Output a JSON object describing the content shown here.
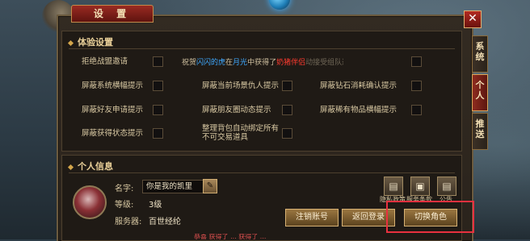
{
  "window": {
    "title": "设 置",
    "close": "✕"
  },
  "side_tabs": {
    "system": "系统",
    "personal": "个人",
    "push": "推送"
  },
  "experience": {
    "title": "体验设置",
    "options": [
      {
        "label": "拒绝战盟邀请"
      },
      {
        "label": "屏蔽系统横幅提示"
      },
      {
        "label": "屏蔽当前场景仇人提示"
      },
      {
        "label": "屏蔽钻石消耗确认提示"
      },
      {
        "label": "屏蔽好友申请提示"
      },
      {
        "label": "屏蔽朋友圈动态提示"
      },
      {
        "label": "屏蔽稀有物品横幅提示"
      },
      {
        "label": "屏蔽获得状态提示"
      },
      {
        "label": "整理背包自动绑定所有不可交易道具"
      }
    ],
    "marquee": {
      "p1": "祝贺",
      "p2": "闪闪的虎",
      "p3": "在",
      "p4": "月光",
      "p5": "中获得了",
      "p6": "奶猪伴侣",
      "p7": "动接受组队邀请"
    }
  },
  "personal": {
    "title": "个人信息",
    "name_label": "名字:",
    "name_value": "你是我的凯里",
    "level_label": "等级:",
    "level_value": "3级",
    "server_label": "服务器:",
    "server_value": "百世经纶",
    "edit_icon": "pencil-icon",
    "icon_buttons": [
      {
        "icon": "document-icon",
        "caption": "隐私政策"
      },
      {
        "icon": "gift-icon",
        "caption": "服务条款"
      },
      {
        "icon": "notice-icon",
        "caption": "公告"
      }
    ],
    "buttons": {
      "logout": "注销账号",
      "back_login": "返回登录",
      "switch_role": "切换角色"
    }
  },
  "bottom_text": "恭喜 获得了 ... 获得了 ..."
}
